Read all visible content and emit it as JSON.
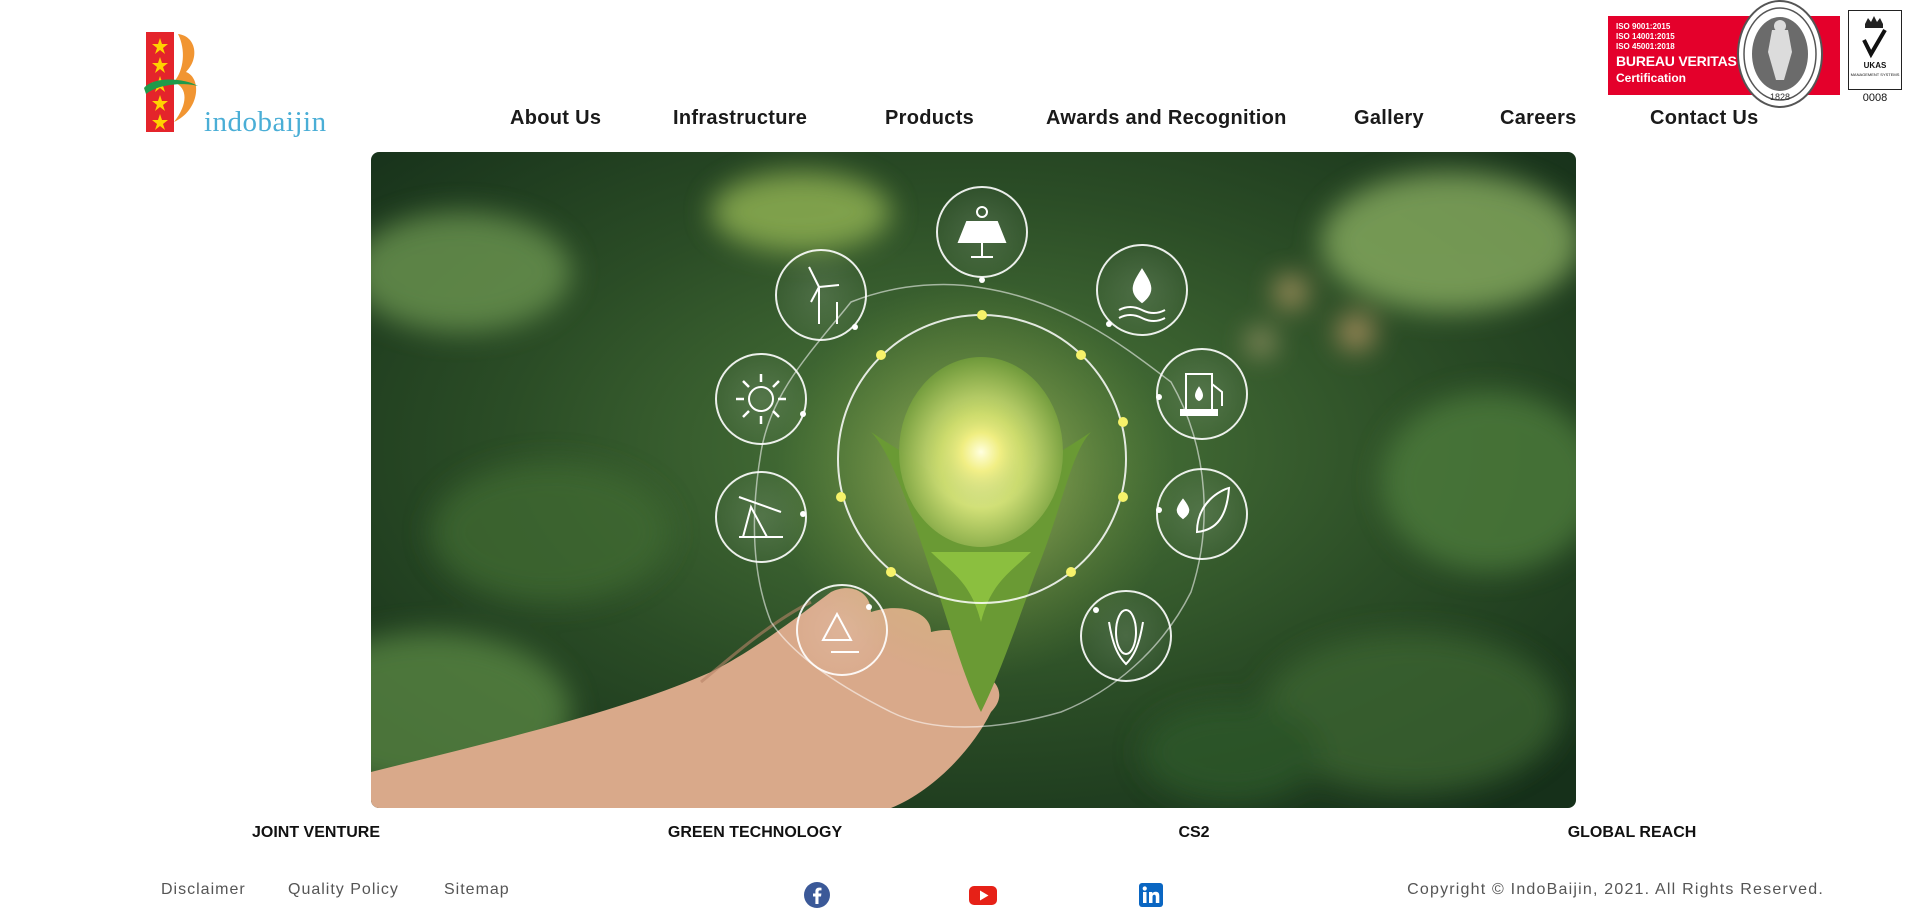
{
  "brand": {
    "name": "indobaijin",
    "colors": {
      "red": "#e4242b",
      "orange": "#f08a1c",
      "green": "#1f9a4a",
      "blue": "#4aaed6"
    }
  },
  "certifications": {
    "bureau_veritas": {
      "lines": [
        "ISO 9001:2015",
        "ISO 14001:2015",
        "ISO 45001:2018"
      ],
      "name": "BUREAU VERITAS",
      "subtitle": "Certification",
      "seal_year": "1828",
      "seal_arc": "BUREAU VERITAS"
    },
    "ukas": {
      "label": "UKAS",
      "sub": "MANAGEMENT SYSTEMS",
      "number": "0008"
    }
  },
  "nav": {
    "items": [
      {
        "label": "About Us"
      },
      {
        "label": "Infrastructure"
      },
      {
        "label": "Products"
      },
      {
        "label": "Awards and Recognition"
      },
      {
        "label": "Gallery"
      },
      {
        "label": "Careers"
      },
      {
        "label": "Contact Us"
      }
    ]
  },
  "hero": {
    "icons": [
      "solar-panel-icon",
      "water-drop-icon",
      "fuel-pump-icon",
      "leaf-drop-icon",
      "corn-icon",
      "recycle-icon",
      "oil-pump-icon",
      "sun-icon",
      "wind-turbine-icon"
    ]
  },
  "features": [
    "JOINT VENTURE",
    "GREEN TECHNOLOGY",
    "CS2",
    "GLOBAL REACH"
  ],
  "footer": {
    "links": [
      "Disclaimer",
      "Quality Policy",
      "Sitemap"
    ],
    "social": [
      {
        "name": "facebook-icon",
        "color": "#3b5998"
      },
      {
        "name": "youtube-icon",
        "color": "#e62117"
      },
      {
        "name": "linkedin-icon",
        "color": "#0a66c2"
      }
    ],
    "copyright": "Copyright © IndoBaijin, 2021. All Rights Reserved."
  }
}
